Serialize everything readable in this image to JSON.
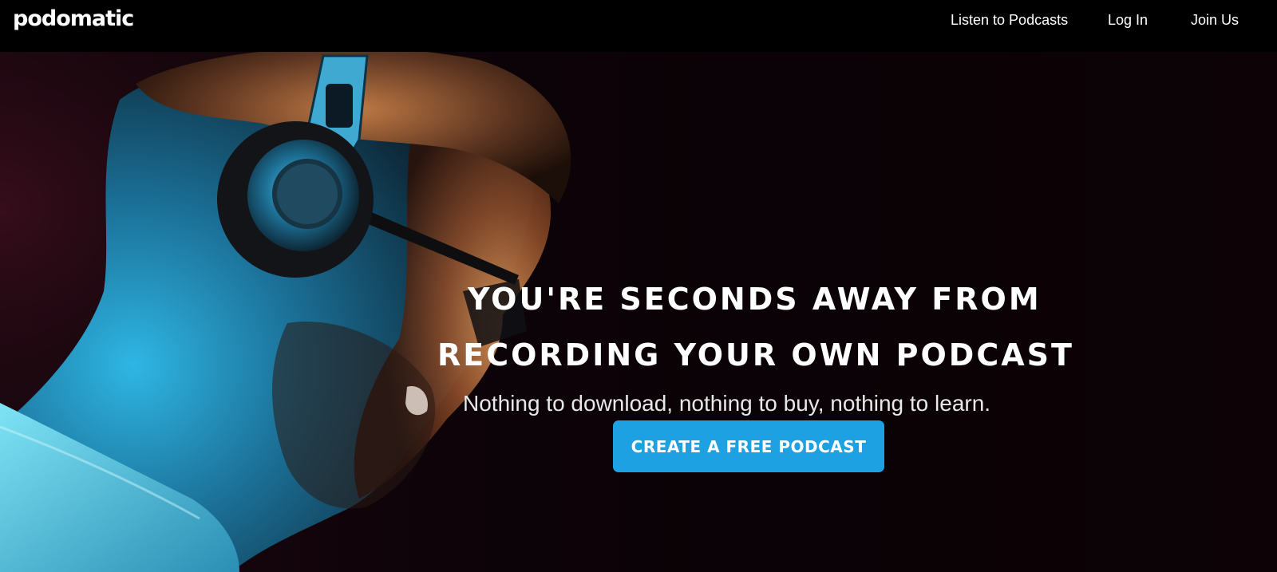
{
  "header": {
    "logo_text": "podomatic",
    "nav": {
      "listen_label": "Listen to Podcasts",
      "login_label": "Log In",
      "join_label": "Join Us"
    }
  },
  "hero": {
    "headline_line1": "YOU'RE SECONDS AWAY FROM",
    "headline_line2": "RECORDING YOUR OWN PODCAST",
    "subheadline": "Nothing to download, nothing to buy, nothing to learn.",
    "cta_label": "CREATE A FREE PODCAST",
    "image_subject": "man-with-headphones-photo"
  },
  "colors": {
    "header_bg": "#000000",
    "hero_bg": "#0b0307",
    "cta_bg": "#1da1e2",
    "text": "#ffffff"
  }
}
